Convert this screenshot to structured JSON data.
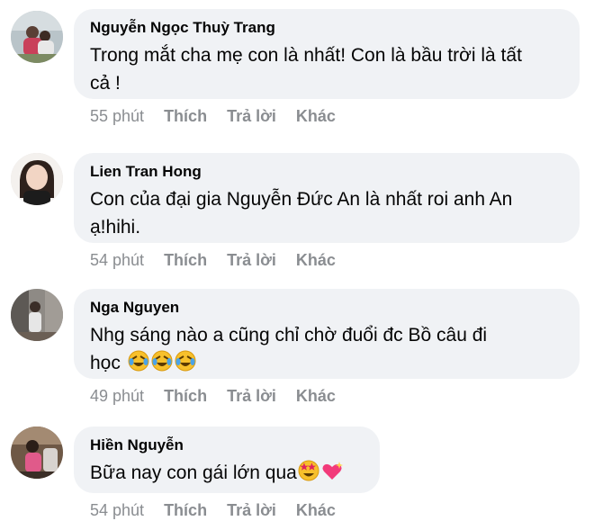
{
  "comments": [
    {
      "name": "Nguyễn Ngọc Thuỳ Trang",
      "text_line1": "Trong mắt cha mẹ con là nhất! Con là bầu trời là tất",
      "text_line2": "cả !",
      "time": "55 phút",
      "like": "Thích",
      "reply": "Trả lời",
      "more": "Khác"
    },
    {
      "name": "Lien Tran Hong",
      "text_line1": "Con của đại gia Nguyễn Đức An là nhất roi anh An",
      "text_line2": "ạ!hihi.",
      "time": "54 phút",
      "like": "Thích",
      "reply": "Trả lời",
      "more": "Khác"
    },
    {
      "name": "Nga Nguyen",
      "text_line1": "Nhg sáng nào a cũng chỉ chờ đuổi đc Bồ câu đi",
      "text_line2": "học",
      "emojis": [
        "rolling-laughing-emoji",
        "rolling-laughing-emoji",
        "rolling-laughing-emoji"
      ],
      "time": "49 phút",
      "like": "Thích",
      "reply": "Trả lời",
      "more": "Khác"
    },
    {
      "name": "Hiền Nguyễn",
      "text_line1": "Bữa nay con gái lớn qua",
      "emojis": [
        "star-struck-emoji",
        "sparkling-heart-emoji"
      ],
      "time": "54 phút",
      "like": "Thích",
      "reply": "Trả lời",
      "more": "Khác"
    }
  ],
  "colors": {
    "bubble": "#f0f2f5",
    "meta_text": "#8a8d91",
    "body_text": "#050505"
  }
}
